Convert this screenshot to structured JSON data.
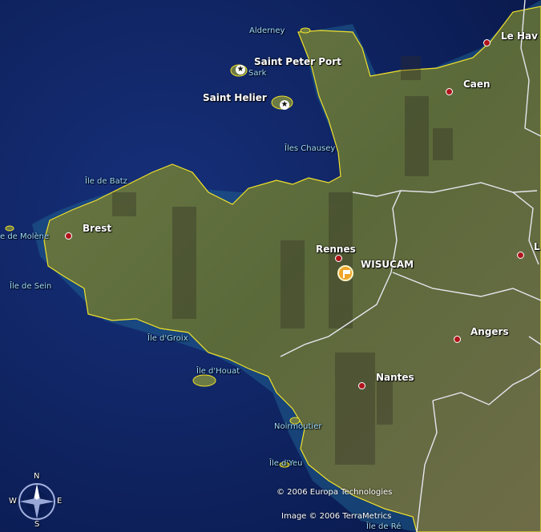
{
  "places": {
    "alderney": "Alderney",
    "saint_peter_port": "Saint Peter Port",
    "sark": "Sark",
    "saint_helier": "Saint Helier",
    "iles_chausey": "Îles Chausey",
    "le_havre": "Le Hav",
    "caen": "Caen",
    "ile_de_batz": "Île de Batz",
    "brest": "Brest",
    "ile_de_molene": "e de Molène",
    "ile_de_sein": "Île de Sein",
    "rennes": "Rennes",
    "wisucam": "WISUCAM",
    "angers": "Angers",
    "laval_partial": "L",
    "ile_de_groix": "Île d'Groix",
    "ile_de_houat": "Île d'Houat",
    "nantes": "Nantes",
    "noirmoutier": "Noirmoutier",
    "ile_d_yeu": "Île d'Yeu",
    "ile_de_re": "Île de Ré"
  },
  "credits": {
    "europa": "© 2006 Europa Technologies",
    "terrametrics": "Image © 2006 TerraMetrics"
  },
  "compass": {
    "n": "N",
    "s": "S",
    "e": "E",
    "w": "W"
  },
  "colors": {
    "sea": "#0d1f5c",
    "land": "#5d6b3c",
    "coast": "#f2e22a",
    "border": "#e6e6ee",
    "city_dot": "#b0131b",
    "placemark": "#f0a526"
  }
}
